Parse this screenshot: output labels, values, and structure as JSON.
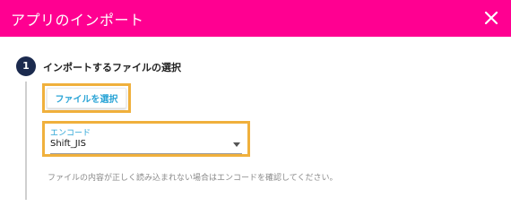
{
  "header": {
    "title": "アプリのインポート",
    "close_icon": "close-icon",
    "background_color": "#ff0091"
  },
  "step": {
    "number": "1",
    "title": "インポートするファイルの選択"
  },
  "file_select": {
    "button_label": "ファイルを選択"
  },
  "encoding": {
    "label": "エンコード",
    "selected_value": "Shift_JIS",
    "dropdown_icon": "chevron-down-icon"
  },
  "hint": {
    "text": "ファイルの内容が正しく読み込まれない場合はエンコードを確認してください。"
  },
  "colors": {
    "accent_blue": "#2aa4d6",
    "highlight_orange": "#f0b03c",
    "step_navy": "#1b2a4e"
  }
}
